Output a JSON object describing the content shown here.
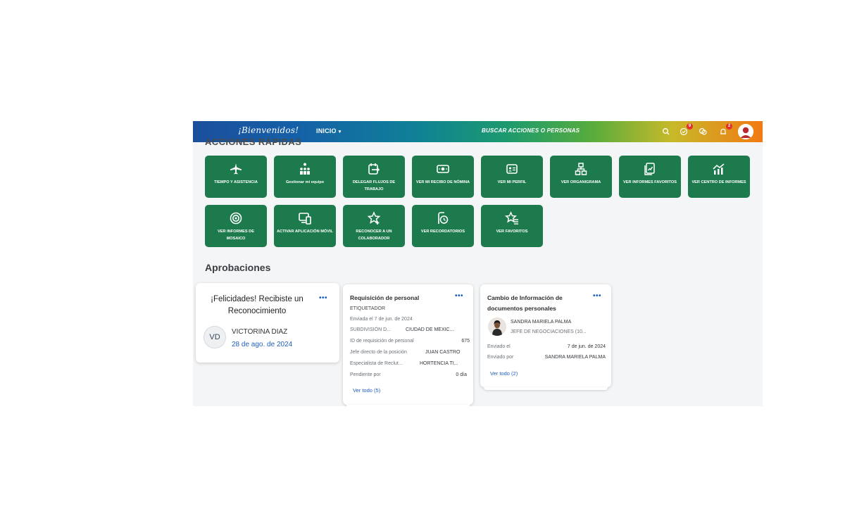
{
  "header": {
    "brand": "¡Bienvenidos!",
    "home_label": "INICIO",
    "home_caret": "▾",
    "search_label": "BUSCAR ACCIONES O PERSONAS",
    "approvals_badge": "9",
    "notifications_badge": "2"
  },
  "quick_actions_heading": "ACCIONES RÁPIDAS",
  "tiles": [
    {
      "label": "TIEMPO Y ASISTENCIA",
      "icon": "airplane-icon"
    },
    {
      "label": "Gestionar mi equipo",
      "icon": "team-icon"
    },
    {
      "label": "DELEGAR FLUJOS DE TRABAJO",
      "icon": "calendar-delegate-icon"
    },
    {
      "label": "VER MI RECIBO DE NÓMINA",
      "icon": "money-icon"
    },
    {
      "label": "VER MI PERFIL",
      "icon": "profile-card-icon"
    },
    {
      "label": "VER ORGANIGRAMA",
      "icon": "org-chart-icon"
    },
    {
      "label": "VER INFORMES FAVORITOS",
      "icon": "report-icon"
    },
    {
      "label": "VER CENTRO DE INFORMES",
      "icon": "report-center-icon"
    },
    {
      "label": "VER INFORMES DE MOSAICO",
      "icon": "target-icon"
    },
    {
      "label": "ACTIVAR APLICACIÓN MÓVIL",
      "icon": "mobile-device-icon"
    },
    {
      "label": "RECONOCER A UN COLABORADOR",
      "icon": "star-add-icon"
    },
    {
      "label": "VER RECORDATORIOS",
      "icon": "reminder-icon"
    },
    {
      "label": "VER FAVORITOS",
      "icon": "star-list-icon"
    }
  ],
  "approvals": {
    "title": "Aprobaciones",
    "card1": {
      "title": "¡Felicidades! Recibiste un Reconocimiento",
      "initials": "VD",
      "name": "VICTORINA DIAZ",
      "date": "28 de ago. de 2024",
      "menu": "•••"
    },
    "card2": {
      "title": "Requisición de personal",
      "menu": "•••",
      "subtitle": "ETIQUETADOR",
      "sent": "Enviada el 7 de jun. de 2024",
      "rows": [
        {
          "label": "SUBDIVISIÓN D...",
          "value": "CIUDAD DE MEXIC..."
        },
        {
          "label": "ID de requisición de personal",
          "value": "675"
        },
        {
          "label": "Jefe directo de la posición",
          "value": "JUAN CASTRO"
        },
        {
          "label": "Especialista de Reclut...",
          "value": "HORTENCIA TI..."
        },
        {
          "label": "Pendiente por",
          "value": "0 día"
        }
      ],
      "link": "Ver todo (5)"
    },
    "card3": {
      "title": "Cambio de Información de documentos personales",
      "menu": "•••",
      "person_name": "SANDRA MARIELA PALMA",
      "person_role": "JEFE DE NEGOCIACIONES (10...",
      "rows": [
        {
          "label": "Enviado el",
          "value": "7 de jun. de 2024"
        },
        {
          "label": "Enviado por",
          "value": "SANDRA MARIELA PALMA"
        }
      ],
      "link": "Ver todo (2)"
    }
  },
  "colors": {
    "tile": "#1c7a4d",
    "link": "#1f5fbf",
    "badge": "#e0302a"
  }
}
